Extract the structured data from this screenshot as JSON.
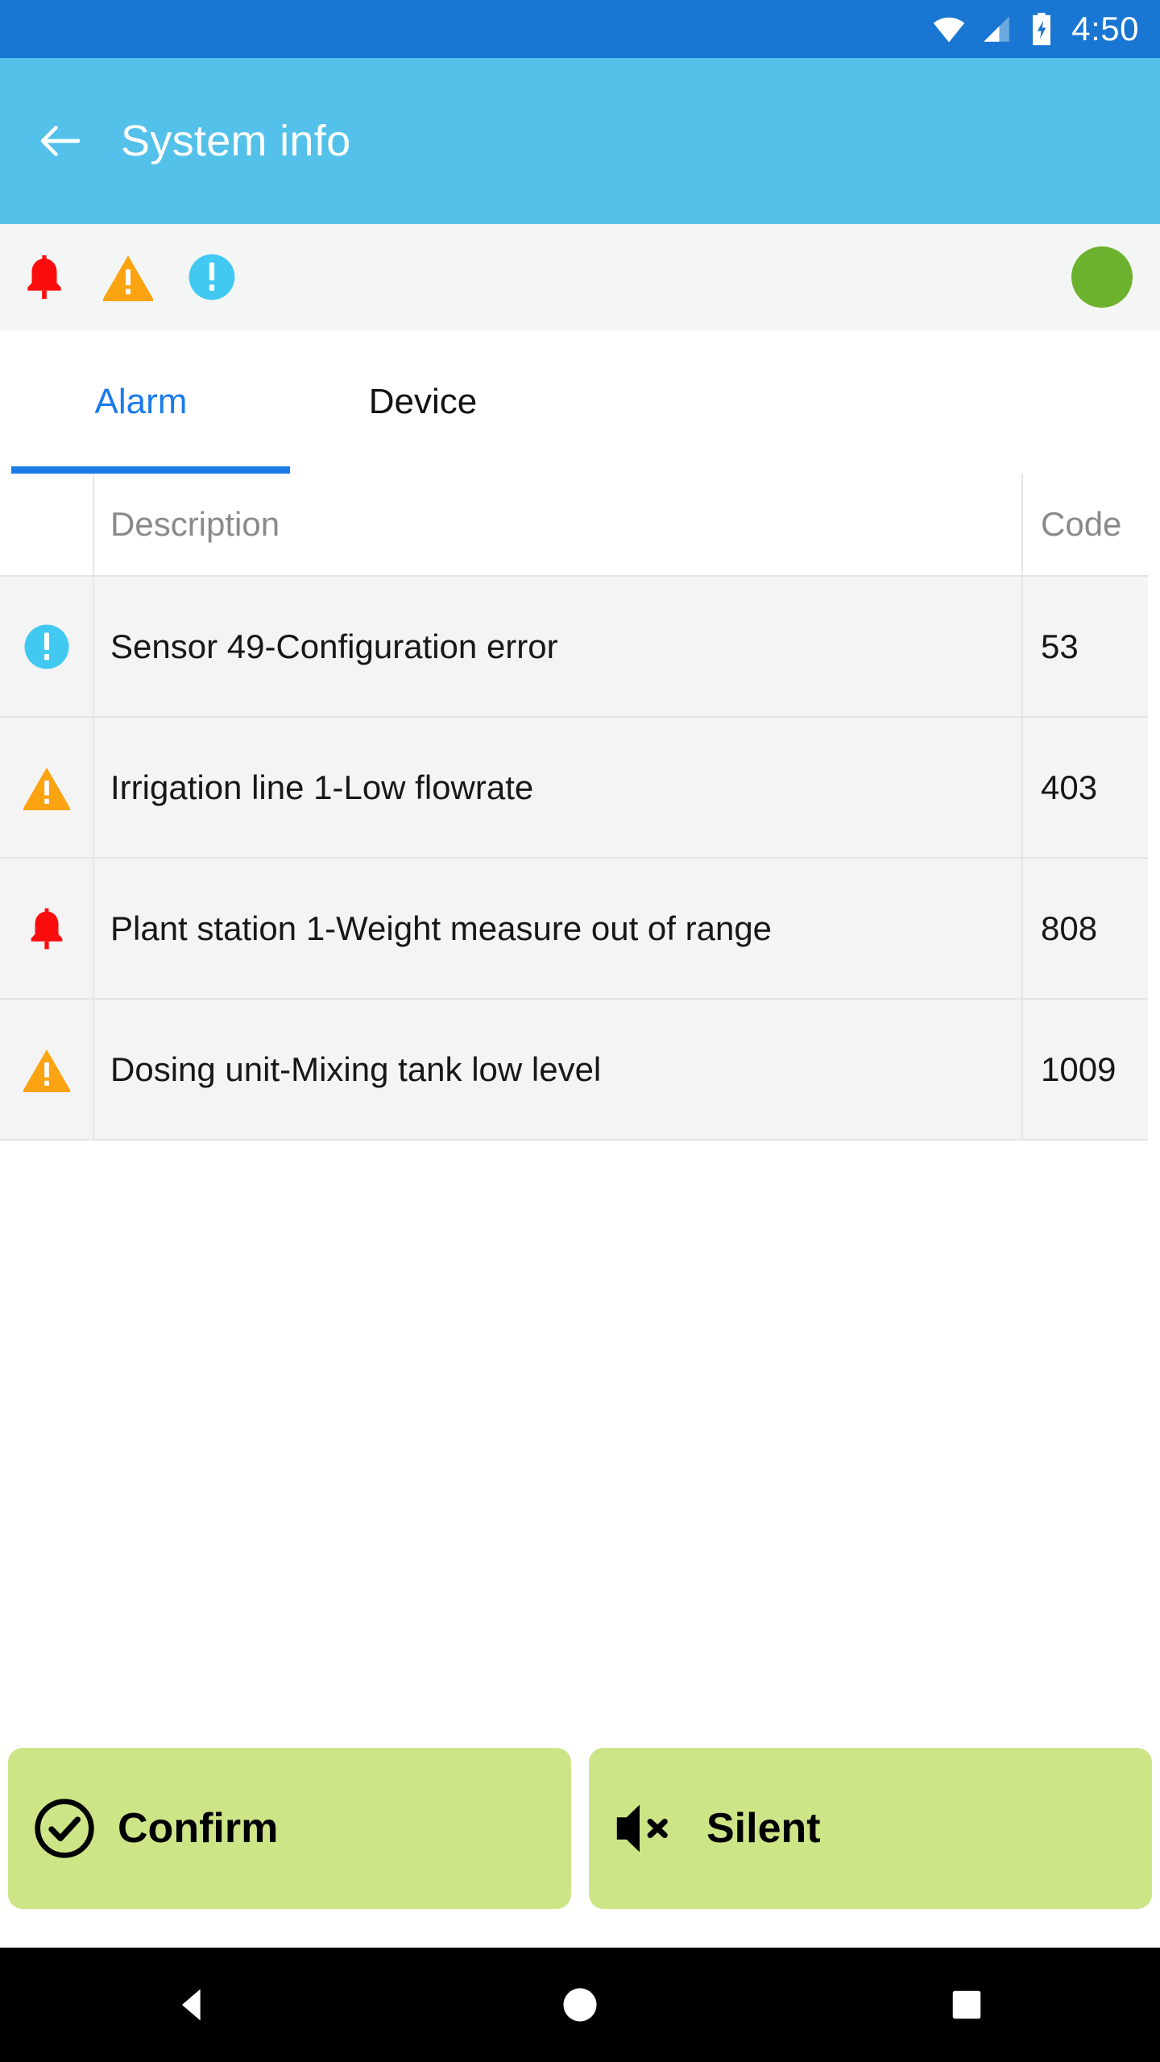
{
  "status_bar": {
    "time": "4:50",
    "icons": [
      "wifi-icon",
      "cell-signal-icon",
      "battery-charging-icon"
    ]
  },
  "app_bar": {
    "back_icon": "back-arrow-icon",
    "title": "System info"
  },
  "alarm_strip": {
    "icons": [
      "alarm-bell-icon",
      "warning-triangle-icon",
      "info-circle-icon"
    ],
    "status_indicator": "green-status-circle",
    "colors": {
      "alarm": "#fb0d0d",
      "warning": "#fca311",
      "info": "#41c9f2",
      "ok": "#6cb22e"
    }
  },
  "tabs": {
    "active_index": 0,
    "items": [
      {
        "label": "Alarm"
      },
      {
        "label": "Device"
      }
    ],
    "accent_color": "#1a7bea"
  },
  "table": {
    "columns": [
      "",
      "Description",
      "Code"
    ],
    "rows": [
      {
        "severity": "info",
        "description": "Sensor 49-Configuration error",
        "code": "53"
      },
      {
        "severity": "warning",
        "description": "Irrigation line 1-Low flowrate",
        "code": "403"
      },
      {
        "severity": "alarm",
        "description": "Plant station 1-Weight measure out of range",
        "code": "808"
      },
      {
        "severity": "warning",
        "description": "Dosing unit-Mixing tank low level",
        "code": "1009"
      }
    ]
  },
  "actions": {
    "buttons": [
      {
        "label": "Confirm",
        "icon": "check-circle-icon"
      },
      {
        "label": "Silent",
        "icon": "speaker-mute-icon"
      }
    ],
    "background_color": "#cde587"
  },
  "nav_bar": {
    "items": [
      "back-triangle-icon",
      "home-circle-icon",
      "recents-square-icon"
    ]
  }
}
